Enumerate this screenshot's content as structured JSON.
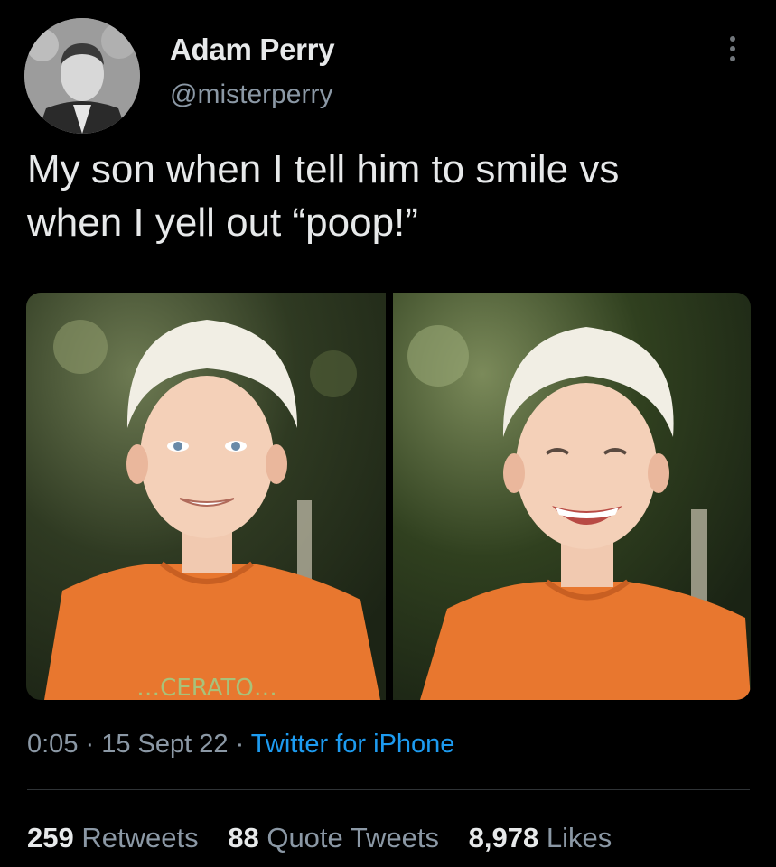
{
  "user": {
    "display_name": "Adam Perry",
    "handle": "@misterperry"
  },
  "tweet": {
    "text": "My son when I tell him to smile vs\nwhen I yell out “poop!”",
    "media": [
      {
        "shirt_text": "…CERATO…",
        "shirt_color": "#e8772f"
      },
      {
        "shirt_color": "#e8772f"
      }
    ]
  },
  "meta": {
    "time": "0:05",
    "separator": " · ",
    "date": "15 Sept 22",
    "source": "Twitter for iPhone"
  },
  "stats": {
    "retweets_count": "259",
    "retweets_label": "Retweets",
    "quotes_count": "88",
    "quotes_label": "Quote Tweets",
    "likes_count": "8,978",
    "likes_label": "Likes"
  },
  "colors": {
    "background": "#000000",
    "text_primary": "#e7e9ea",
    "text_secondary": "#8b98a5",
    "link": "#1d9bf0"
  },
  "icons": {
    "more": "more-vertical-icon"
  }
}
